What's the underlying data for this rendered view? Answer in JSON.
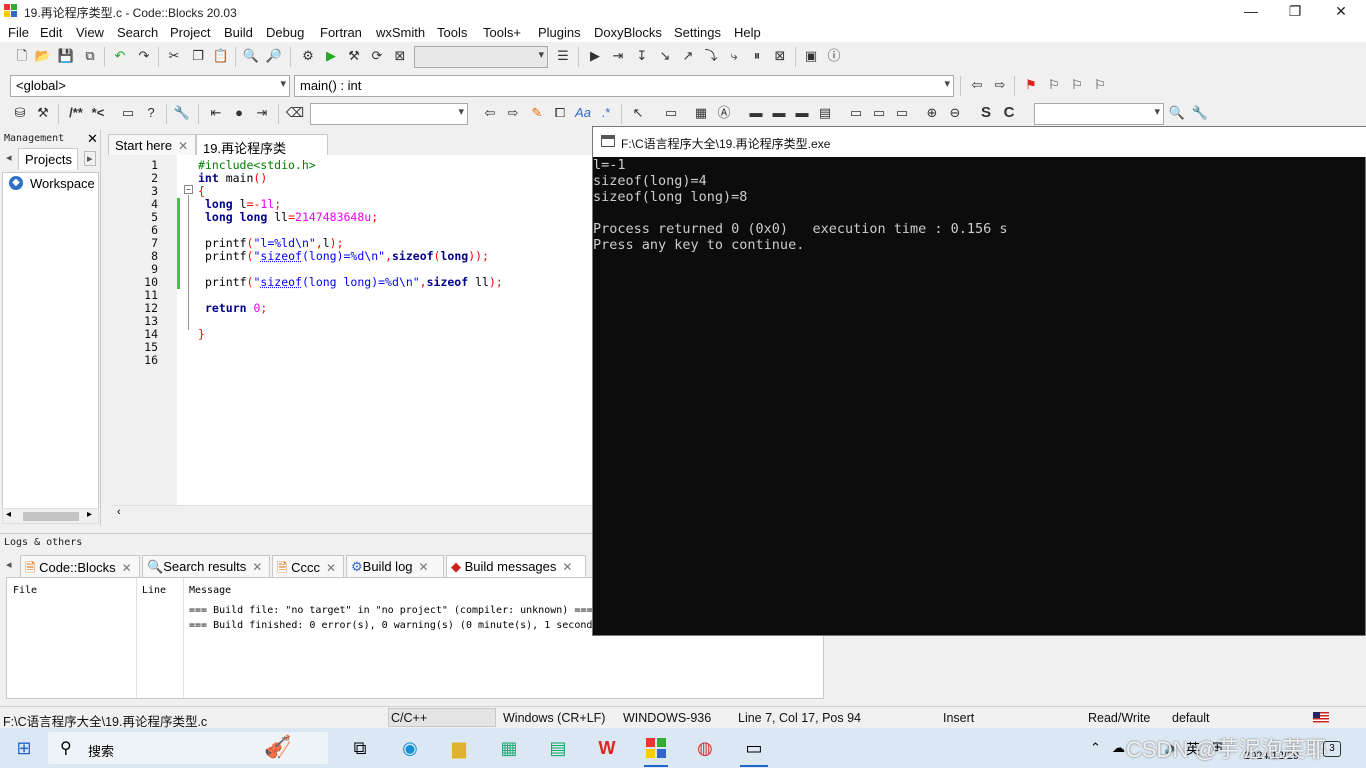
{
  "window": {
    "title": "19.再论程序类型.c - Code::Blocks 20.03",
    "minimize": "—",
    "maximize": "❐",
    "close": "✕"
  },
  "menu": [
    "File",
    "Edit",
    "View",
    "Search",
    "Project",
    "Build",
    "Debug",
    "Fortran",
    "wxSmith",
    "Tools",
    "Tools+",
    "Plugins",
    "DoxyBlocks",
    "Settings",
    "Help"
  ],
  "toolbar": {
    "scope_combo": "<global>",
    "function_combo": "main() : int",
    "comment_block": "/**",
    "uncomment": "*<",
    "letter_s": "S",
    "letter_c": "C"
  },
  "management": {
    "title": "Management",
    "tab": "Projects",
    "workspace": "Workspace"
  },
  "editor": {
    "tabs": [
      "Start here",
      "19.再论程序类型.c"
    ],
    "active_tab": "19.再论程序类型.c",
    "line_numbers": [
      "1",
      "2",
      "3",
      "4",
      "5",
      "6",
      "7",
      "8",
      "9",
      "10",
      "11",
      "12",
      "13",
      "14",
      "15",
      "16"
    ]
  },
  "logs": {
    "title": "Logs & others",
    "tabs": [
      "Code::Blocks",
      "Search results",
      "Cccc",
      "Build log",
      "Build messages"
    ],
    "columns": [
      "File",
      "Line",
      "Message"
    ],
    "messages": [
      "=== Build file: \"no target\" in \"no project\" (compiler: unknown) ===",
      "=== Build finished: 0 error(s), 0 warning(s) (0 minute(s), 1 second"
    ]
  },
  "console": {
    "title": "F:\\C语言程序大全\\19.再论程序类型.exe",
    "lines": [
      "l=-1",
      "sizeof(long)=4",
      "sizeof(long long)=8",
      "",
      "Process returned 0 (0x0)   execution time : 0.156 s",
      "Press any key to continue."
    ]
  },
  "status": {
    "file": "F:\\C语言程序大全\\19.再论程序类型.c",
    "language": "C/C++",
    "eol": "Windows (CR+LF)",
    "encoding": "WINDOWS-936",
    "position": "Line 7, Col 17, Pos 94",
    "mode": "Insert",
    "access": "Read/Write",
    "profile": "default"
  },
  "taskbar": {
    "search": "搜索",
    "tray_lang": "英",
    "date": "2024/12/29",
    "watermark": "CSDN @芋泥泡芙耶",
    "notification_count": "3"
  },
  "colors": {
    "console_bg": "#0c0c0c",
    "keyword": "#00008b",
    "preprocessor": "#008000",
    "number": "#f000f0",
    "string": "#0000ff"
  }
}
